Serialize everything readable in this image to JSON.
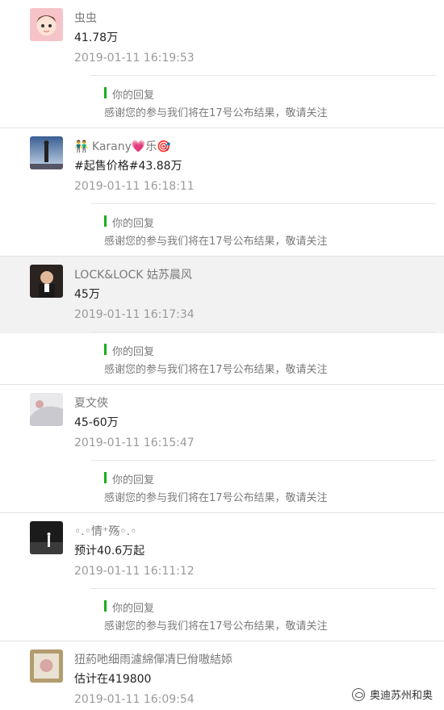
{
  "comments": [
    {
      "name": "虫虫",
      "content": "41.78万",
      "time": "2019-01-11 16:19:53",
      "reply_label": "你的回复",
      "reply_text": "感谢您的参与我们将在17号公布结果，敬请关注"
    },
    {
      "name": "👬 Karany💗乐🎯",
      "content": "#起售价格#43.88万",
      "time": "2019-01-11 16:18:11",
      "reply_label": "你的回复",
      "reply_text": "感谢您的参与我们将在17号公布结果，敬请关注"
    },
    {
      "name": "LOCK&LOCK 姑苏晨风",
      "content": "45万",
      "time": "2019-01-11 16:17:34",
      "reply_label": "你的回复",
      "reply_text": "感谢您的参与我们将在17号公布结果，敬请关注"
    },
    {
      "name": "夏文俠",
      "content": "45-60万",
      "time": "2019-01-11 16:15:47",
      "reply_label": "你的回复",
      "reply_text": "感谢您的参与我们将在17号公布结果，敬请关注"
    },
    {
      "name": "◦.◦情⁺殇◦.◦",
      "content": "预计40.6万起",
      "time": "2019-01-11 16:11:12",
      "reply_label": "你的回复",
      "reply_text": "感谢您的参与我们将在17号公布结果，敬请关注"
    },
    {
      "name": "狃葯吔细雨濾綿僤凊巳佾嗷結婖",
      "content": "估计在419800",
      "time": "2019-01-11 16:09:54"
    }
  ],
  "brand": "奥迪苏州和奥"
}
